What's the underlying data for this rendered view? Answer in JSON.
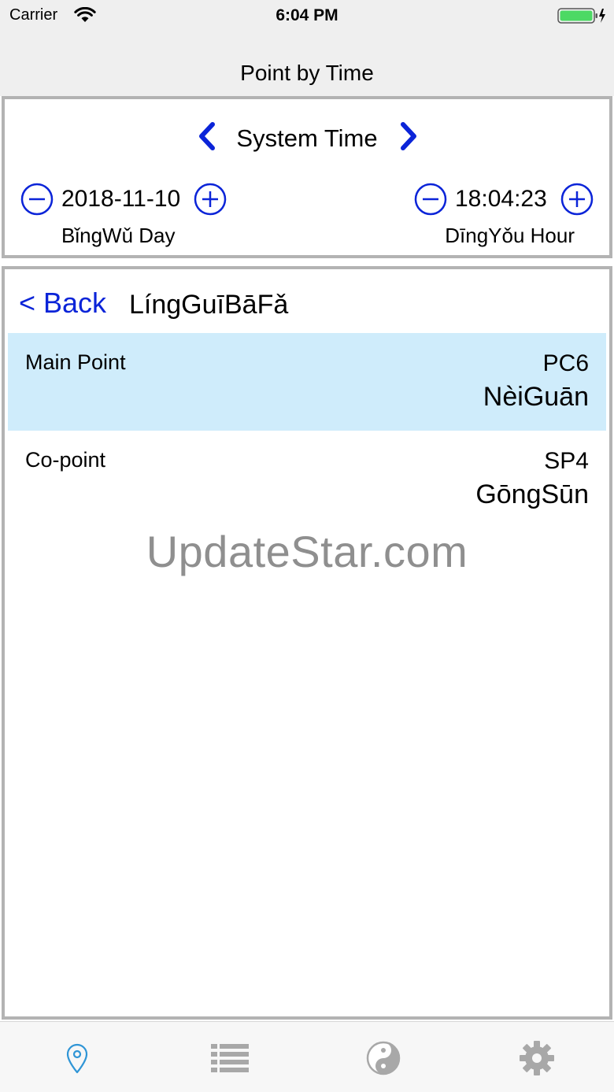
{
  "status_bar": {
    "carrier": "Carrier",
    "time": "6:04 PM",
    "battery_color": "#4cd964"
  },
  "nav": {
    "title": "Point by Time"
  },
  "time_panel": {
    "title": "System Time",
    "date": "2018-11-10",
    "time": "18:04:23",
    "day_label": "BǐngWǔ Day",
    "hour_label": "DīngYǒu Hour",
    "accent_color": "#0b24d8"
  },
  "content": {
    "back_label": "< Back",
    "title": "LíngGuīBāFǎ",
    "rows": [
      {
        "label": "Main Point",
        "code": "PC6",
        "name": "NèiGuān",
        "highlight": "#cfecfb"
      },
      {
        "label": "Co-point",
        "code": "SP4",
        "name": "GōngSūn"
      }
    ],
    "watermark": "UpdateStar.com"
  },
  "tab_bar": {
    "tabs": [
      {
        "icon": "location-pin-icon",
        "active": true
      },
      {
        "icon": "list-icon",
        "active": false
      },
      {
        "icon": "yin-yang-icon",
        "active": false
      },
      {
        "icon": "gear-icon",
        "active": false
      }
    ],
    "active_color": "#2f95d6",
    "inactive_color": "#a8a8a8"
  }
}
